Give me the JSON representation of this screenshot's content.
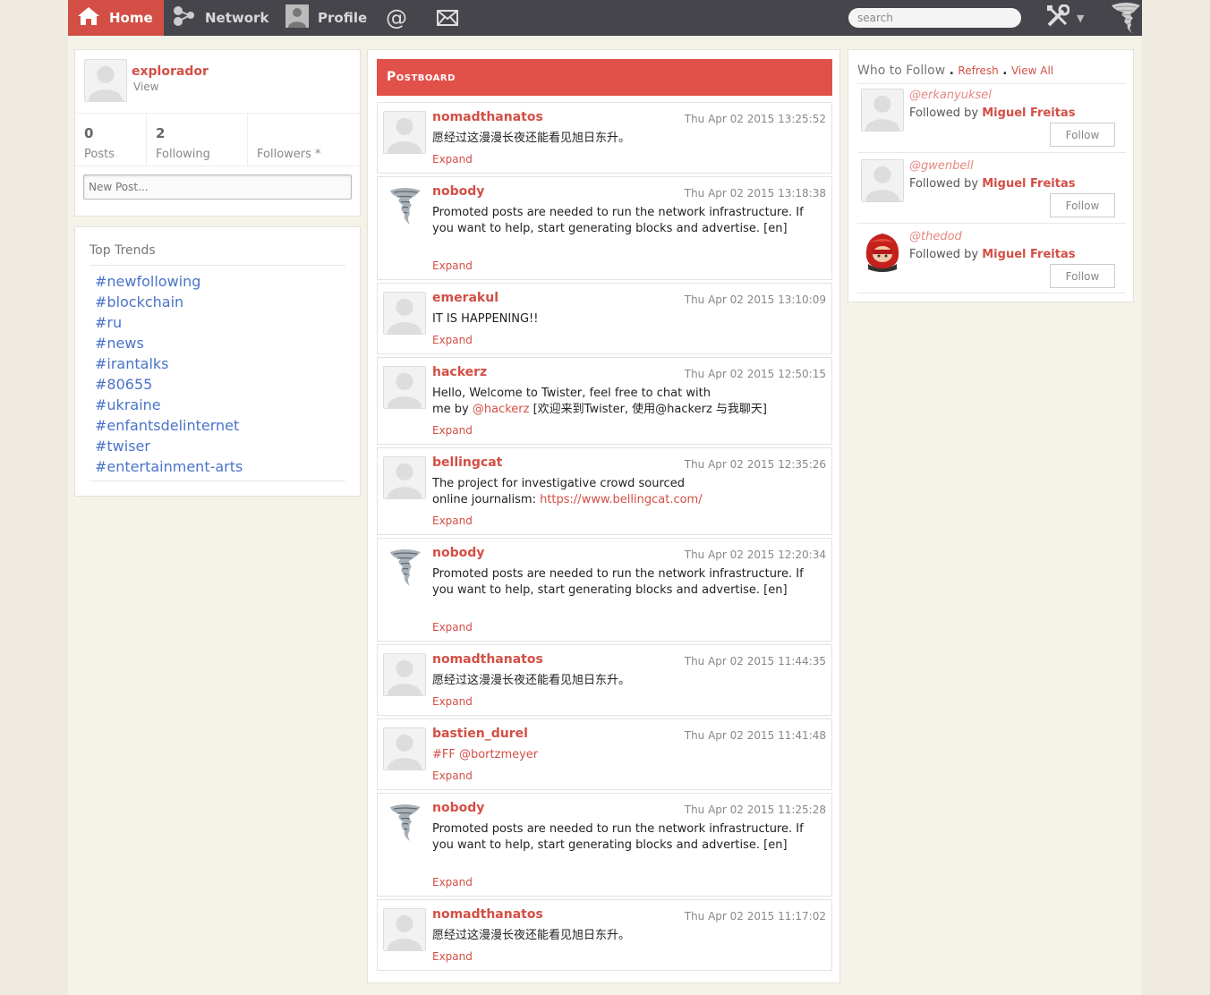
{
  "nav": {
    "home": "Home",
    "network": "Network",
    "profile": "Profile",
    "mentions_glyph": "@",
    "search_placeholder": "search"
  },
  "profile": {
    "username": "explorador",
    "view_label": "View",
    "stats": [
      {
        "num": "0",
        "label": "Posts"
      },
      {
        "num": "2",
        "label": "Following"
      },
      {
        "num": "",
        "label": "Followers *"
      }
    ],
    "new_post_placeholder": "New Post..."
  },
  "trends": {
    "title": "Top Trends",
    "items": [
      "#newfollowing",
      "#blockchain",
      "#ru",
      "#news",
      "#irantalks",
      "#80655",
      "#ukraine",
      "#enfantsdelinternet",
      "#twiser",
      "#entertainment-arts"
    ]
  },
  "postboard": {
    "title": "Postboard",
    "expand_label": "Expand",
    "posts": [
      {
        "author": "nomadthanatos",
        "time": "Thu Apr 02 2015 13:25:52",
        "text": "愿经过这漫漫长夜还能看见旭日东升。",
        "avatar": "placeholder-avatar"
      },
      {
        "author": "nobody",
        "time": "Thu Apr 02 2015 13:18:38",
        "text": "Promoted posts are needed to run the network infrastructure. If you want to help, start generating blocks and advertise. [en]",
        "avatar": "tornado-avatar"
      },
      {
        "author": "emerakul",
        "time": "Thu Apr 02 2015 13:10:09",
        "text": "IT IS HAPPENING!!",
        "avatar": "placeholder-avatar"
      },
      {
        "author": "hackerz",
        "time": "Thu Apr 02 2015 12:50:15",
        "text_line1": "Hello, Welcome to Twister, feel free to chat with",
        "text_pre": "me by ",
        "text_link": "@hackerz",
        "text_post": " [欢迎来到Twister, 使用@hackerz 与我聊天]",
        "avatar": "placeholder-avatar"
      },
      {
        "author": "bellingcat",
        "time": "Thu Apr 02 2015 12:35:26",
        "text_line1": "The project for investigative crowd sourced",
        "text_pre": "online journalism: ",
        "text_link": "https://www.bellingcat.com/",
        "avatar": "placeholder-avatar"
      },
      {
        "author": "nobody",
        "time": "Thu Apr 02 2015 12:20:34",
        "text": "Promoted posts are needed to run the network infrastructure. If you want to help, start generating blocks and advertise. [en]",
        "avatar": "tornado-avatar"
      },
      {
        "author": "nomadthanatos",
        "time": "Thu Apr 02 2015 11:44:35",
        "text": "愿经过这漫漫长夜还能看见旭日东升。",
        "avatar": "placeholder-avatar"
      },
      {
        "author": "bastien_durel",
        "time": "Thu Apr 02 2015 11:41:48",
        "text_link": "#FF @bortzmeyer",
        "avatar": "placeholder-avatar"
      },
      {
        "author": "nobody",
        "time": "Thu Apr 02 2015 11:25:28",
        "text": "Promoted posts are needed to run the network infrastructure. If you want to help, start generating blocks and advertise. [en]",
        "avatar": "tornado-avatar"
      },
      {
        "author": "nomadthanatos",
        "time": "Thu Apr 02 2015 11:17:02",
        "text": "愿经过这漫漫长夜还能看见旭日东升。",
        "avatar": "placeholder-avatar"
      }
    ]
  },
  "who_to_follow": {
    "title": "Who to Follow",
    "refresh": "Refresh",
    "view_all": "View All",
    "followed_by_label": "Followed by",
    "follow_label": "Follow",
    "items": [
      {
        "handle": "@erkanyuksel",
        "followed_by": "Miguel Freitas",
        "avatar": "placeholder-avatar"
      },
      {
        "handle": "@gwenbell",
        "followed_by": "Miguel Freitas",
        "avatar": "placeholder-avatar"
      },
      {
        "handle": "@thedod",
        "followed_by": "Miguel Freitas",
        "avatar": "red-hood-avatar"
      }
    ]
  },
  "colors": {
    "accent": "#d34f45",
    "topbar": "#45454b",
    "postboard_header": "#e2504a",
    "trend_link": "#4a73c9"
  }
}
